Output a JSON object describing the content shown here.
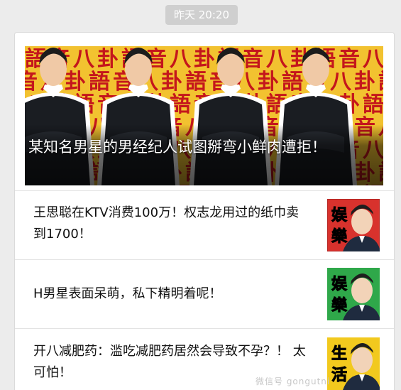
{
  "timestamp": "昨天 20:20",
  "hero": {
    "title": "某知名男星的男经纪人试图掰弯小鲜肉遭拒！",
    "banner_text": [
      "語",
      "音",
      "八",
      "卦"
    ]
  },
  "articles": [
    {
      "title": "王思聪在KTV消费100万！权志龙用过的纸巾卖到1700！",
      "tag": [
        "娱",
        "樂"
      ],
      "tag_bg": "#d8322d"
    },
    {
      "title": "H男星表面呆萌，私下精明着呢！",
      "tag": [
        "娱",
        "樂"
      ],
      "tag_bg": "#2fa84a"
    },
    {
      "title": "开八减肥药：滥吃减肥药居然会导致不孕？！ 太可怕！",
      "tag": [
        "生",
        "活"
      ],
      "tag_bg": "#f2c91e"
    }
  ],
  "watermark": "微信号 gongutni",
  "colors": {
    "banner_bg": "#f2c230",
    "banner_char": "#c4161c",
    "card_border": "#dadada"
  }
}
